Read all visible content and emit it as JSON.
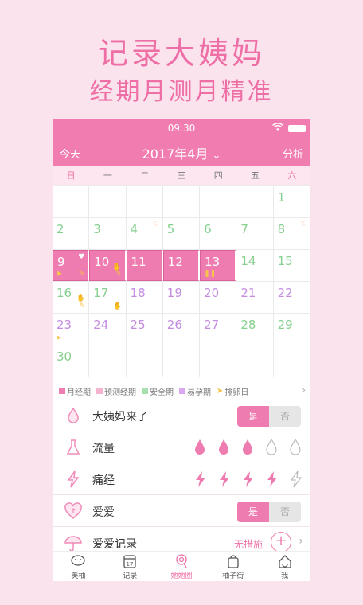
{
  "promo": {
    "line1": "记录大姨妈",
    "line2": "经期月测月精准"
  },
  "status": {
    "time": "09:30"
  },
  "header": {
    "today": "今天",
    "month": "2017年4月",
    "analysis": "分析"
  },
  "weekdays": [
    "日",
    "一",
    "二",
    "三",
    "四",
    "五",
    "六"
  ],
  "calendar": {
    "weeks": [
      [
        "",
        "",
        "",
        "",
        "",
        "",
        "1"
      ],
      [
        "2",
        "3",
        "4",
        "5",
        "6",
        "7",
        "8"
      ],
      [
        "9",
        "10",
        "11",
        "12",
        "13",
        "14",
        "15"
      ],
      [
        "16",
        "17",
        "18",
        "19",
        "20",
        "21",
        "22"
      ],
      [
        "23",
        "24",
        "25",
        "26",
        "27",
        "28",
        "29"
      ],
      [
        "30",
        "",
        "",
        "",
        "",
        "",
        ""
      ]
    ],
    "day_colors": {
      "safe": "#86cf8f",
      "pregnant": "#c48de0",
      "predicted": "#f08bb8",
      "period": "#ffffff"
    }
  },
  "legend": {
    "items": [
      {
        "label": "月经期",
        "color": "#ee7cb0"
      },
      {
        "label": "预测经期",
        "color": "#f6b3cf"
      },
      {
        "label": "安全期",
        "color": "#a8dfae"
      },
      {
        "label": "易孕期",
        "color": "#d9a8ee"
      },
      {
        "label": "排卵日",
        "color": "#f7c34a"
      }
    ]
  },
  "records": {
    "period_came": {
      "label": "大姨妈来了",
      "yes": "是",
      "no": "否"
    },
    "flow": {
      "label": "流量",
      "level": 3,
      "max": 5
    },
    "cramps": {
      "label": "痛经",
      "level": 4,
      "max": 5
    },
    "love": {
      "label": "爱爱",
      "yes": "是",
      "no": "否"
    },
    "love_record": {
      "label": "爱爱记录",
      "measure": "无措施"
    }
  },
  "tabs": [
    {
      "label": "美柚"
    },
    {
      "label": "记录",
      "icon_text": "17"
    },
    {
      "label": "她她圈"
    },
    {
      "label": "柚子街"
    },
    {
      "label": "我"
    }
  ],
  "colors": {
    "accent": "#ee6fa5",
    "header": "#f07cb0"
  }
}
